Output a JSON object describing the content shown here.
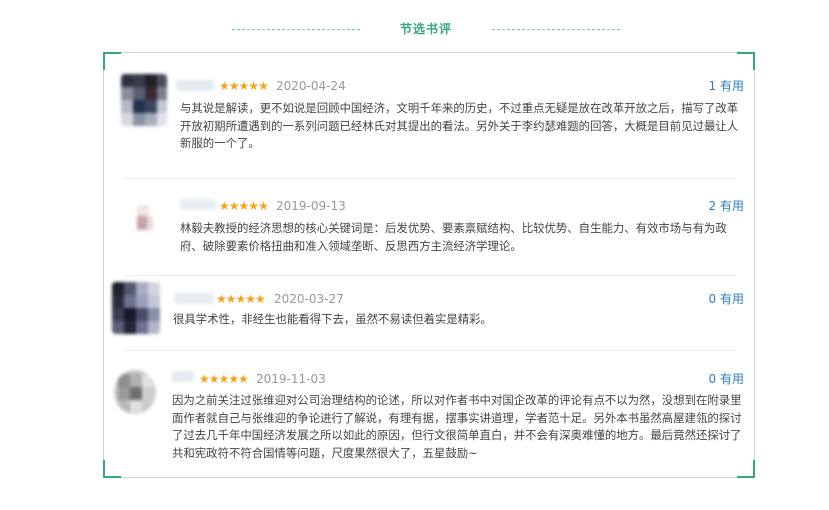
{
  "section": {
    "title": "节选书评"
  },
  "reviews": [
    {
      "rating_stars": "★★★★★",
      "rating": 5,
      "date": "2020-04-24",
      "useful_count": "1",
      "useful_label": "有用",
      "content": "与其说是解读，更不如说是回顾中国经济，文明千年来的历史，不过重点无疑是放在改革开放之后，描写了改革开放初期所遭遇到的一系列问题已经林氏对其提出的看法。另外关于李约瑟难题的回答，大概是目前见过最让人新服的一个了。"
    },
    {
      "rating_stars": "★★★★★",
      "rating": 5,
      "date": "2019-09-13",
      "useful_count": "2",
      "useful_label": "有用",
      "content": "林毅夫教授的经济思想的核心关键词是：后发优势、要素禀赋结构、比较优势、自生能力、有效市场与有为政府、破除要素价格扭曲和准入领域垄断、反思西方主流经济学理论。"
    },
    {
      "rating_stars": "★★★★★",
      "rating": 5,
      "date": "2020-03-27",
      "useful_count": "0",
      "useful_label": "有用",
      "content": "很具学术性，非经生也能看得下去，虽然不易读但着实是精彩。"
    },
    {
      "rating_stars": "★★★★★",
      "rating": 5,
      "date": "2019-11-03",
      "useful_count": "0",
      "useful_label": "有用",
      "content": "因为之前关注过张维迎对公司治理结构的论述，所以对作者书中对国企改革的评论有点不以为然，没想到在附录里面作者就自己与张维迎的争论进行了解说，有理有据，摆事实讲道理，学者范十足。另外本书虽然高屋建瓴的探讨了过去几千年中国经济发展之所以如此的原因，但行文很简单直白，并不会有深奥难懂的地方。最后竟然还探讨了共和宪政符不符合国情等问题，尺度果然很大了，五星鼓励~"
    }
  ]
}
